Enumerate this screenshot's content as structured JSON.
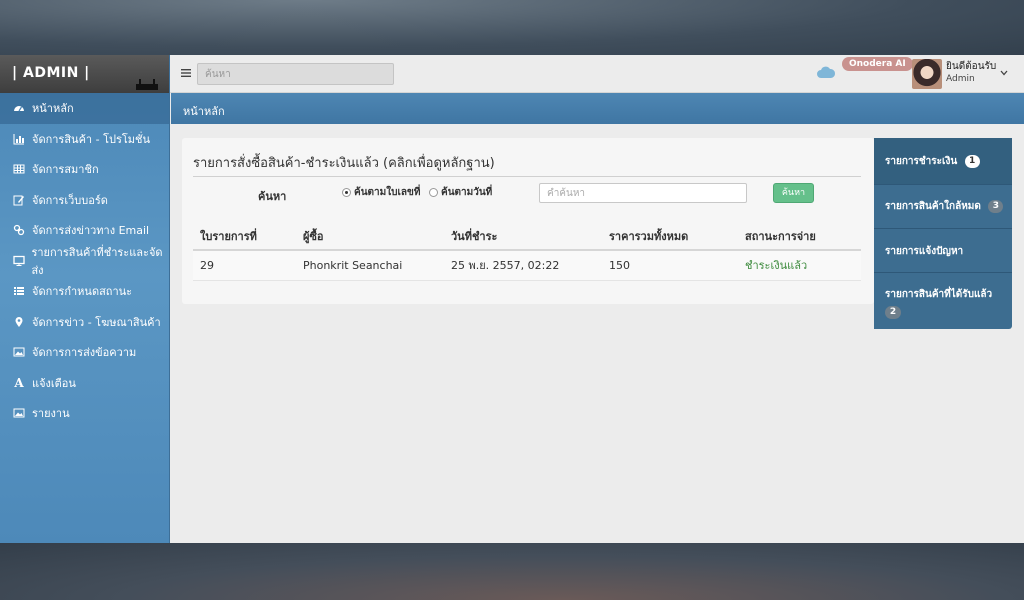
{
  "logo": "| ADMIN |",
  "sidebar": {
    "items": [
      {
        "label": "หน้าหลัก",
        "icon": "dashboard-icon"
      },
      {
        "label": "จัดการสินค้า - โปรโมชั่น",
        "icon": "bar-chart-icon"
      },
      {
        "label": "จัดการสมาชิก",
        "icon": "table-icon"
      },
      {
        "label": "จัดการเว็บบอร์ด",
        "icon": "edit-icon"
      },
      {
        "label": "จัดการส่งข่าวทาง Email",
        "icon": "link-icon"
      },
      {
        "label": "รายการสินค้าที่ชำระและจัดส่ง",
        "icon": "monitor-icon"
      },
      {
        "label": "จัดการกำหนดสถานะ",
        "icon": "list-icon"
      },
      {
        "label": "จัดการข่าว - โฆษณาสินค้า",
        "icon": "map-marker-icon"
      },
      {
        "label": "จัดการการส่งข้อความ",
        "icon": "picture-icon"
      },
      {
        "label": "แจ้งเตือน",
        "icon": "font-icon"
      },
      {
        "label": "รายงาน",
        "icon": "picture-icon"
      }
    ]
  },
  "topbar": {
    "search_placeholder": "ค้นหา",
    "brand_pill": "Onodera AI",
    "welcome": "ยินดีต้อนรับ",
    "role": "Admin"
  },
  "breadcrumb": "หน้าหลัก",
  "panel": {
    "title": "รายการสั่งซื้อสินค้า-ชำระเงินแล้ว (คลิกเพื่อดูหลักฐาน)",
    "search_label": "ค้นหา",
    "radio_by_invoice": "ค้นตามใบเลขที่",
    "radio_by_date": "ค้นตามวันที่",
    "search_placeholder": "คำค้นหา",
    "search_button": "ค้นหา",
    "table": {
      "headers": [
        "ใบรายการที่",
        "ผู้ซื้อ",
        "วันที่ชำระ",
        "ราคารวมทั้งหมด",
        "สถานะการจ่าย"
      ],
      "rows": [
        [
          "29",
          "Phonkrit Seanchai",
          "25 พ.ย. 2557, 02:22",
          "150",
          "ชำระเงินแล้ว"
        ]
      ]
    }
  },
  "right_tabs": [
    {
      "label": "รายการชำระเงิน",
      "badge": "1"
    },
    {
      "label": "รายการสินค้าใกล้หมด",
      "badge": "3"
    },
    {
      "label": "รายการแจ้งปัญหา",
      "badge": ""
    },
    {
      "label": "รายการสินค้าที่ได้รับแล้ว",
      "badge": "2"
    }
  ],
  "colors": {
    "sidebar": "#5b97c4",
    "breadcrumb": "#4e86b3",
    "right_tabs": "#3d6d90",
    "search_button": "#65c08b",
    "paid_status": "#3d8b3d",
    "brand_pill": "#c9928f"
  }
}
